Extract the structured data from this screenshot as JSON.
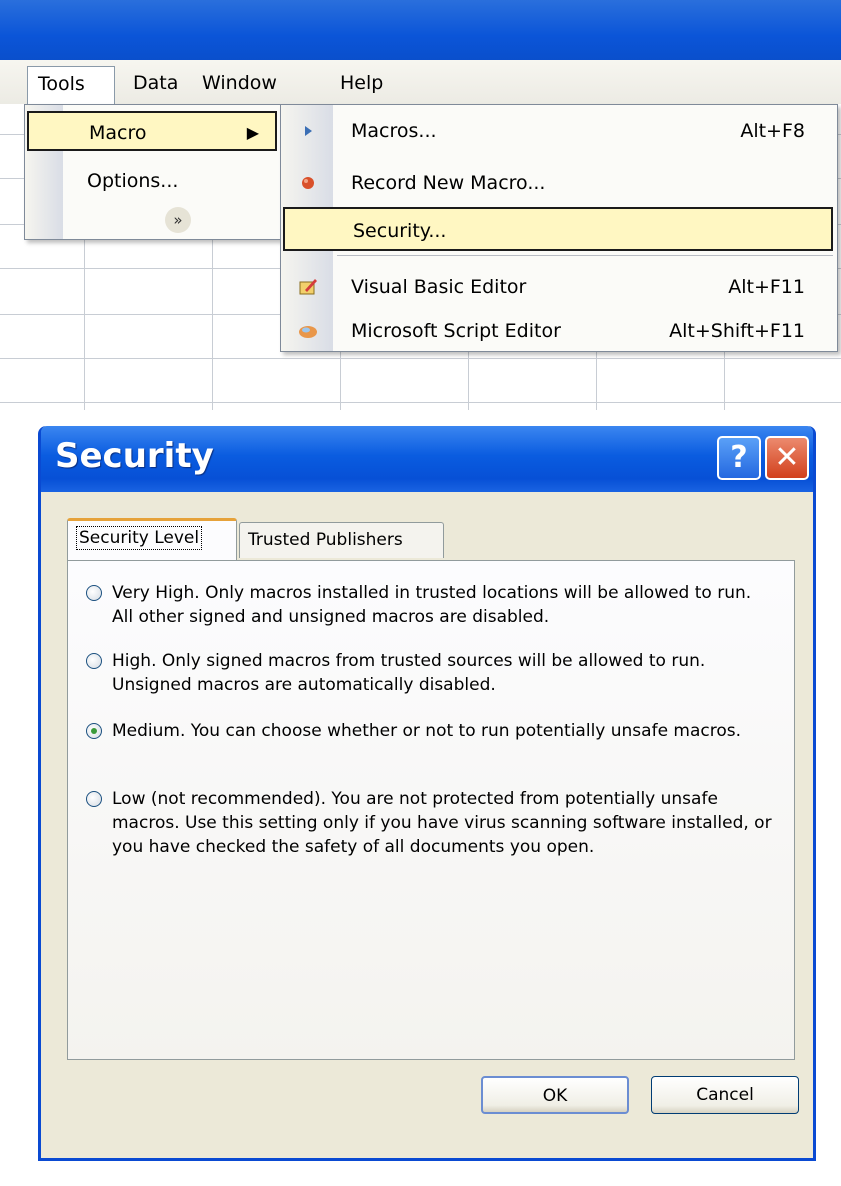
{
  "menubar": {
    "tools": "Tools",
    "data": "Data",
    "window": "Window",
    "help": "Help"
  },
  "tools_menu": {
    "macro": "Macro",
    "options": "Options...",
    "expand_icon": "chevron-double-down-icon"
  },
  "macro_submenu": {
    "items": [
      {
        "label": "Macros...",
        "shortcut": "Alt+F8",
        "icon": "play-icon"
      },
      {
        "label": "Record New Macro...",
        "shortcut": "",
        "icon": "record-icon"
      },
      {
        "label": "Security...",
        "shortcut": "",
        "icon": ""
      },
      {
        "label": "Visual Basic Editor",
        "shortcut": "Alt+F11",
        "icon": "vb-editor-icon"
      },
      {
        "label": "Microsoft Script Editor",
        "shortcut": "Alt+Shift+F11",
        "icon": "script-editor-icon"
      }
    ]
  },
  "dialog": {
    "title": "Security",
    "tabs": [
      "Security Level",
      "Trusted Publishers"
    ],
    "selected_tab": "Security Level",
    "options": [
      {
        "label": "Very High. Only macros installed in trusted locations will be allowed to run. All other signed and unsigned macros are disabled.",
        "selected": false
      },
      {
        "label": "High. Only signed macros from trusted sources will be allowed to run. Unsigned macros are automatically disabled.",
        "selected": false
      },
      {
        "label": "Medium. You can choose whether or not to run potentially unsafe macros.",
        "selected": true
      },
      {
        "label": "Low (not recommended). You are not protected from potentially unsafe macros. Use this setting only if you have virus scanning software installed, or you have checked the safety of all documents you open.",
        "selected": false
      }
    ],
    "ok_label": "OK",
    "cancel_label": "Cancel"
  },
  "colors": {
    "title_blue": "#0a5ce0",
    "highlight": "#fff7c2",
    "dialog_bg": "#ece9d8"
  }
}
